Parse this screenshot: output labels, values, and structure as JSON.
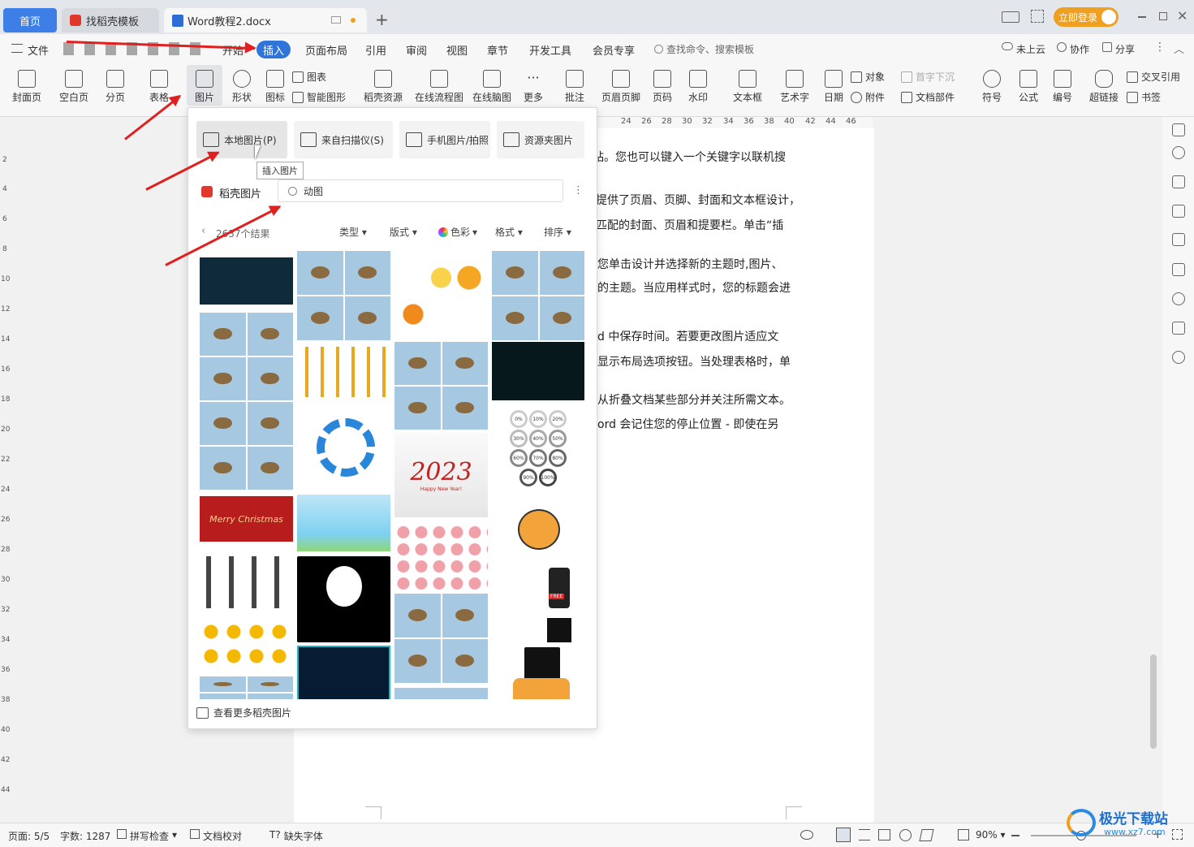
{
  "tabs": {
    "home": "首页",
    "template": "找稻壳模板",
    "doc": "Word教程2.docx",
    "new": "+"
  },
  "window": {
    "login": "立即登录"
  },
  "menubar": {
    "file": "文件",
    "start": "开始",
    "insert": "插入",
    "layout": "页面布局",
    "ref": "引用",
    "review": "审阅",
    "view": "视图",
    "chapter": "章节",
    "dev": "开发工具",
    "member": "会员专享",
    "search": "查找命令、搜索模板",
    "cloud": "未上云",
    "collab": "协作",
    "share": "分享"
  },
  "ribbon": {
    "cover": "封面页",
    "blank": "空白页",
    "pagebreak": "分页",
    "table": "表格",
    "picture": "图片",
    "shape": "形状",
    "icon": "图标",
    "chart": "图表",
    "smartart": "智能图形",
    "daoke": "稻壳资源",
    "flow": "在线流程图",
    "mind": "在线脑图",
    "more": "更多",
    "comment": "批注",
    "header": "页眉页脚",
    "pagenum": "页码",
    "watermark": "水印",
    "textbox": "文本框",
    "arttext": "艺术字",
    "date": "日期",
    "object": "对象",
    "dropcap": "首字下沉",
    "attach": "附件",
    "docpart": "文档部件",
    "symbol": "符号",
    "formula": "公式",
    "number": "编号",
    "hyperlink": "超链接",
    "crossref": "交叉引用",
    "bookmark": "书签"
  },
  "ruler": {
    "ticks": [
      "24",
      "26",
      "28",
      "30",
      "32",
      "34",
      "36",
      "38",
      "40",
      "42",
      "44",
      "46"
    ],
    "vticks": [
      "2",
      "4",
      "6",
      "8",
      "10",
      "12",
      "14",
      "16",
      "18",
      "20",
      "22",
      "24",
      "26",
      "28",
      "30",
      "32",
      "34",
      "36",
      "38",
      "40",
      "42",
      "44"
    ]
  },
  "doc_lines": [
    "您在联机视频中，可以在想要添加的视频的嵌入代码中进行粘贴。您也可以键入一个关键字以联机搜",
    "提供了页眉、页脚、封面和文本框设计，",
    "匹配的封面、页眉和提要栏。单击“插",
    "您单击设计并选择新的主题时,图片、",
    "的主题。当应用样式时，您的标题会进",
    "d 中保存时间。若要更改图片适应文",
    "显示布局选项按钮。当处理表格时，单",
    "从折叠文档某些部分并关注所需文本。",
    "ord 会记住您的停止位置 - 即使在另"
  ],
  "popup": {
    "local": "本地图片(P)",
    "scanner": "来自扫描仪(S)",
    "phone": "手机图片/拍照",
    "folder": "资源夹图片",
    "tooltip": "插入图片",
    "brand": "稻壳图片",
    "search_value": "动图",
    "results": "2637个结果",
    "filters": [
      "类型",
      "版式",
      "色彩",
      "格式",
      "排序"
    ],
    "more_link": "查看更多稻壳图片",
    "thumb_xmas": "Merry Christmas",
    "thumb_year": "2023",
    "thumb_newyear": "Happy New Year!",
    "thumb_free": "FREE",
    "pcts": [
      "0%",
      "10%",
      "20%",
      "30%",
      "40%",
      "50%",
      "60%",
      "70%",
      "80%",
      "90%",
      "100%"
    ]
  },
  "status": {
    "page": "页面: 5/5",
    "words": "字数: 1287",
    "spell": "拼写检查",
    "proof": "文档校对",
    "font": "缺失字体",
    "zoom": "90%"
  },
  "watermark": {
    "name": "极光下载站",
    "url": "www.xz7.com"
  },
  "colors": {
    "accent": "#2e74d9",
    "login": "#f0a020",
    "arrow": "#e02020"
  }
}
